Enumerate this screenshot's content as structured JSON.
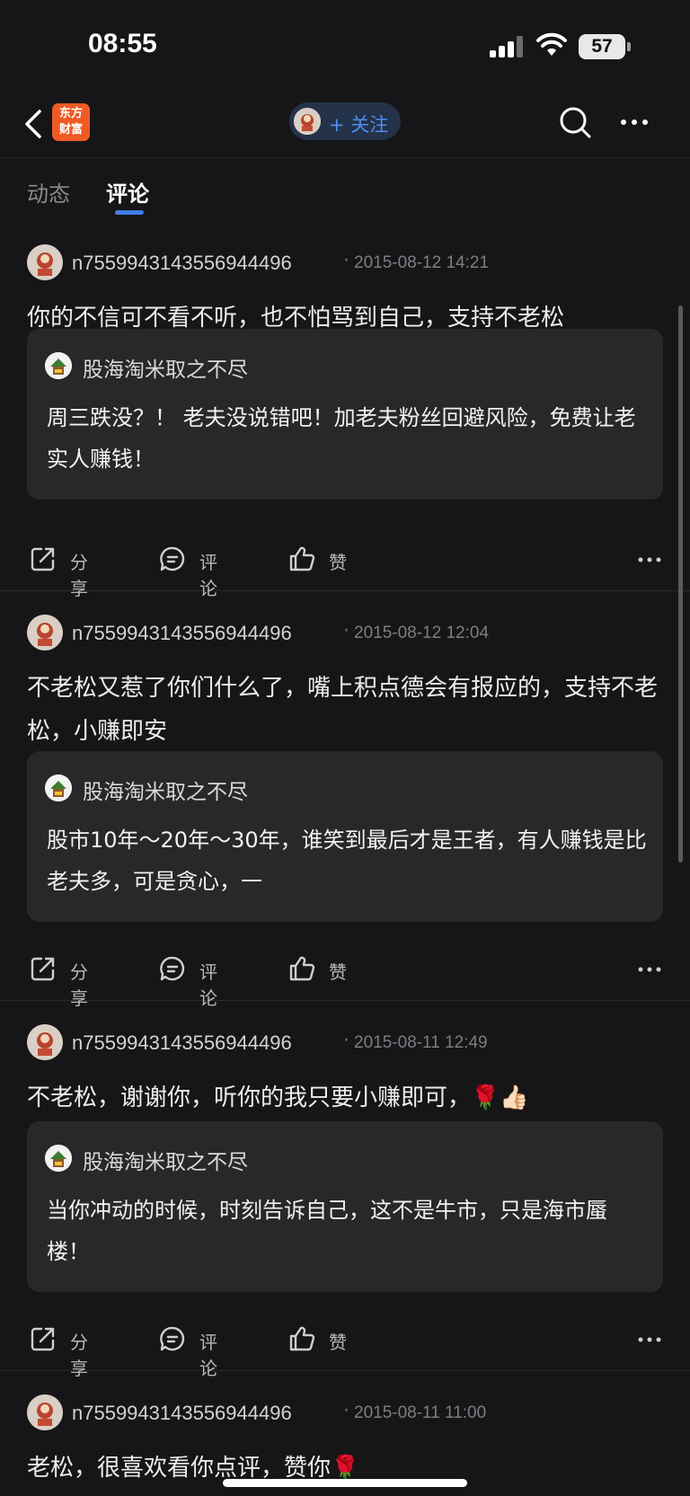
{
  "status_bar": {
    "time": "08:55",
    "battery": "57"
  },
  "nav": {
    "logo_line1": "东方",
    "logo_line2": "财富",
    "follow_label": "+ 关注"
  },
  "tabs": [
    {
      "label": "动态",
      "active": false
    },
    {
      "label": "评论",
      "active": true
    }
  ],
  "posts": [
    {
      "username": "n7559943143556944496",
      "separator": "·",
      "timestamp": "2015-08-12 14:21",
      "text": "你的不信可不看不听，也不怕骂到自己，支持不老松",
      "quote": {
        "author": "股海淘米取之不尽",
        "text": "周三跌没？！ 老夫没说错吧！加老夫粉丝回避风险，免费让老实人赚钱！"
      },
      "actions": {
        "share": "分享",
        "comment": "评论",
        "like": "赞"
      }
    },
    {
      "username": "n7559943143556944496",
      "separator": "·",
      "timestamp": "2015-08-12 12:04",
      "text": "不老松又惹了你们什么了，嘴上积点德会有报应的，支持不老松，小赚即安",
      "quote": {
        "author": "股海淘米取之不尽",
        "text": "股市10年～20年～30年，谁笑到最后才是王者，有人赚钱是比老夫多，可是贪心，一"
      },
      "actions": {
        "share": "分享",
        "comment": "评论",
        "like": "赞"
      }
    },
    {
      "username": "n7559943143556944496",
      "separator": "·",
      "timestamp": "2015-08-11 12:49",
      "text": "不老松，谢谢你，听你的我只要小赚即可，🌹👍🏻",
      "quote": {
        "author": "股海淘米取之不尽",
        "text": "当你冲动的时候，时刻告诉自己，这不是牛市，只是海市蜃楼！"
      },
      "actions": {
        "share": "分享",
        "comment": "评论",
        "like": "赞"
      }
    },
    {
      "username": "n7559943143556944496",
      "separator": "·",
      "timestamp": "2015-08-11 11:00",
      "text": "老松，很喜欢看你点评，赞你🌹"
    }
  ],
  "colors": {
    "background": "#161618",
    "card": "#28282b",
    "accent": "#3f7ee8",
    "brand": "#f05a24"
  },
  "icons": [
    "back-icon",
    "search-icon",
    "more-icon",
    "share-icon",
    "comment-icon",
    "like-icon"
  ]
}
